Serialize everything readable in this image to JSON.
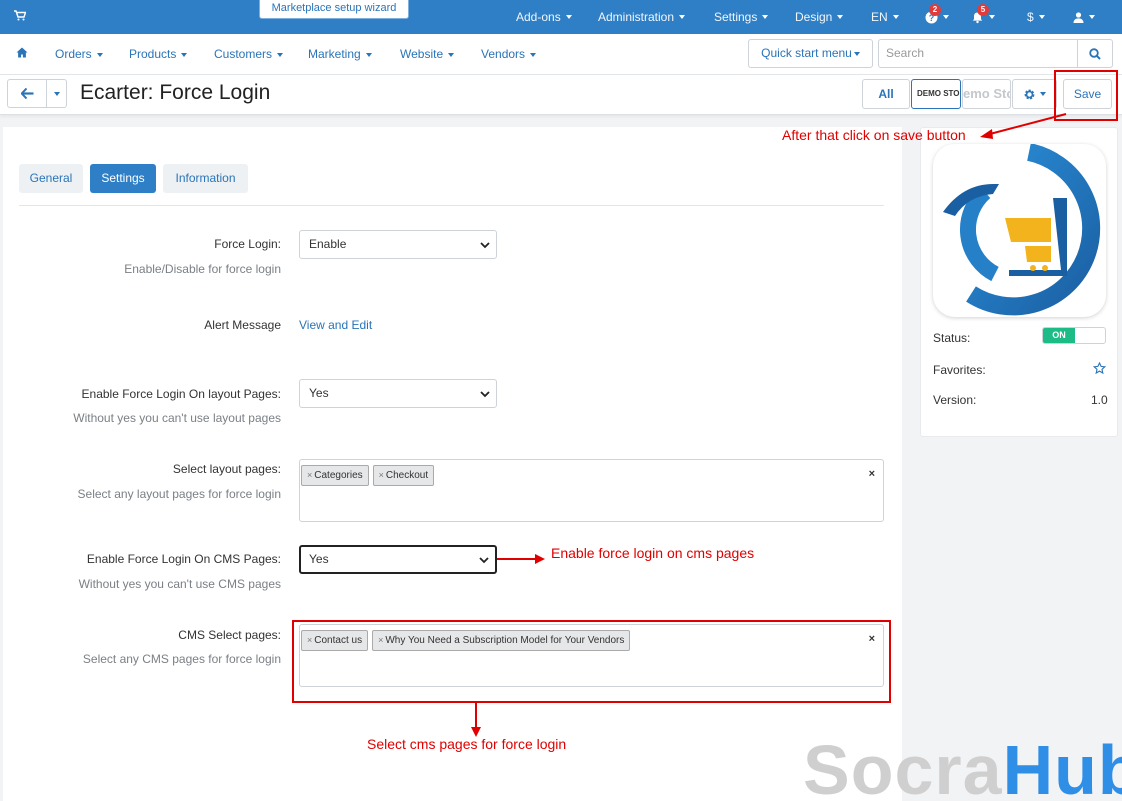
{
  "topbar": {
    "wizard": "Marketplace setup wizard",
    "items": [
      {
        "label": "Add-ons"
      },
      {
        "label": "Administration"
      },
      {
        "label": "Settings"
      },
      {
        "label": "Design"
      },
      {
        "label": "EN"
      }
    ],
    "help_badge": "2",
    "notif_badge": "5",
    "currency": "$"
  },
  "nav": {
    "items": [
      "Orders",
      "Products",
      "Customers",
      "Marketing",
      "Website",
      "Vendors"
    ],
    "quick_start": "Quick start menu",
    "search_placeholder": "Search"
  },
  "titlebar": {
    "title": "Ecarter: Force Login",
    "all": "All",
    "store_short": "DEMO STO",
    "store_long": "emo Sto",
    "save": "Save"
  },
  "tabs": [
    "General",
    "Settings",
    "Information"
  ],
  "form": {
    "force_login": {
      "label": "Force Login:",
      "help": "Enable/Disable for force login",
      "value": "Enable"
    },
    "alert_message": {
      "label": "Alert Message",
      "link": "View and Edit"
    },
    "layout_enable": {
      "label": "Enable Force Login On layout Pages:",
      "help": "Without yes you can't use layout pages",
      "value": "Yes"
    },
    "layout_pages": {
      "label": "Select layout pages:",
      "help": "Select any layout pages for force login",
      "tags": [
        "Categories",
        "Checkout"
      ]
    },
    "cms_enable": {
      "label": "Enable Force Login On CMS Pages:",
      "help": "Without yes you can't use CMS pages",
      "value": "Yes"
    },
    "cms_pages": {
      "label": "CMS Select pages:",
      "help": "Select any CMS pages for force login",
      "tags": [
        "Contact us",
        "Why You Need a Subscription Model for Your Vendors"
      ]
    }
  },
  "sidebar": {
    "status_label": "Status:",
    "status_value": "ON",
    "favorites_label": "Favorites:",
    "version_label": "Version:",
    "version_value": "1.0"
  },
  "annotations": {
    "save": "After that click on save button",
    "cms_enable": "Enable force login on cms pages",
    "cms_pages": "Select cms pages for force login"
  },
  "watermark": {
    "part1": "Socra",
    "part2": "Hub"
  },
  "colors": {
    "primary": "#2f7fc6",
    "annotation": "#e00000",
    "status_on": "#1dbb85"
  }
}
